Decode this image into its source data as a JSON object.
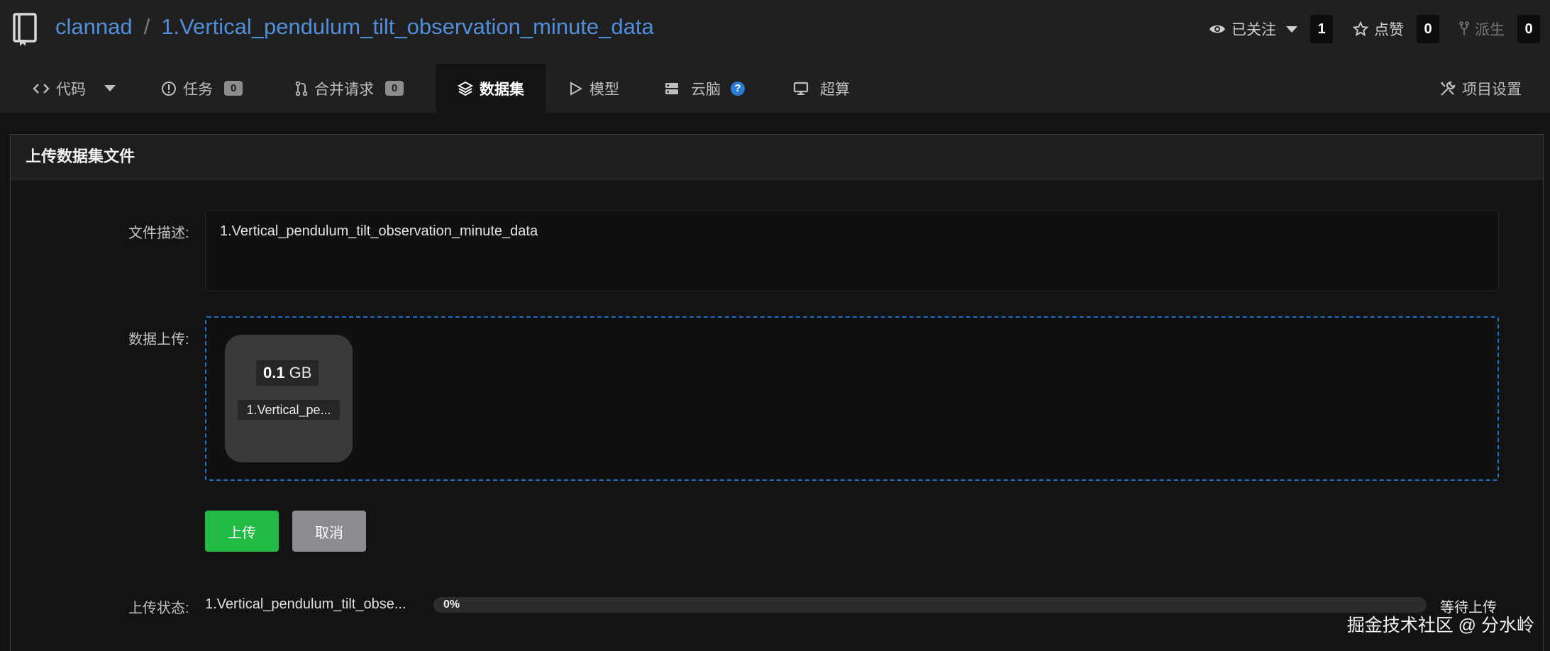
{
  "header": {
    "owner": "clannad",
    "separator": "/",
    "repo": "1.Vertical_pendulum_tilt_observation_minute_data",
    "watch_label": "已关注",
    "watch_count": "1",
    "star_label": "点赞",
    "star_count": "0",
    "fork_label": "派生",
    "fork_count": "0"
  },
  "tabs": {
    "code": "代码",
    "issues": "任务",
    "issues_count": "0",
    "pulls": "合并请求",
    "pulls_count": "0",
    "datasets": "数据集",
    "models": "模型",
    "cloudbrain": "云脑",
    "cloudbrain_help": "?",
    "supercompute": "超算",
    "settings": "项目设置"
  },
  "form": {
    "panel_title": "上传数据集文件",
    "desc_label": "文件描述:",
    "desc_value": "1.Vertical_pendulum_tilt_observation_minute_data",
    "upload_label": "数据上传:",
    "file_size_value": "0.1",
    "file_size_unit": "GB",
    "file_name": "1.Vertical_pe...",
    "upload_button": "上传",
    "cancel_button": "取消",
    "status_label": "上传状态:",
    "status_file": "1.Vertical_pendulum_tilt_obse...",
    "progress": 0,
    "progress_text": "0%",
    "status_text": "等待上传"
  },
  "watermark": "掘金技术社区 @ 分水岭",
  "colors": {
    "background": "#131313",
    "header_background": "#202020",
    "link": "#4f8fdc",
    "upload_button": "#21ba45",
    "cancel_button": "#8a8c90",
    "dropzone_border": "#1f6fc4"
  }
}
